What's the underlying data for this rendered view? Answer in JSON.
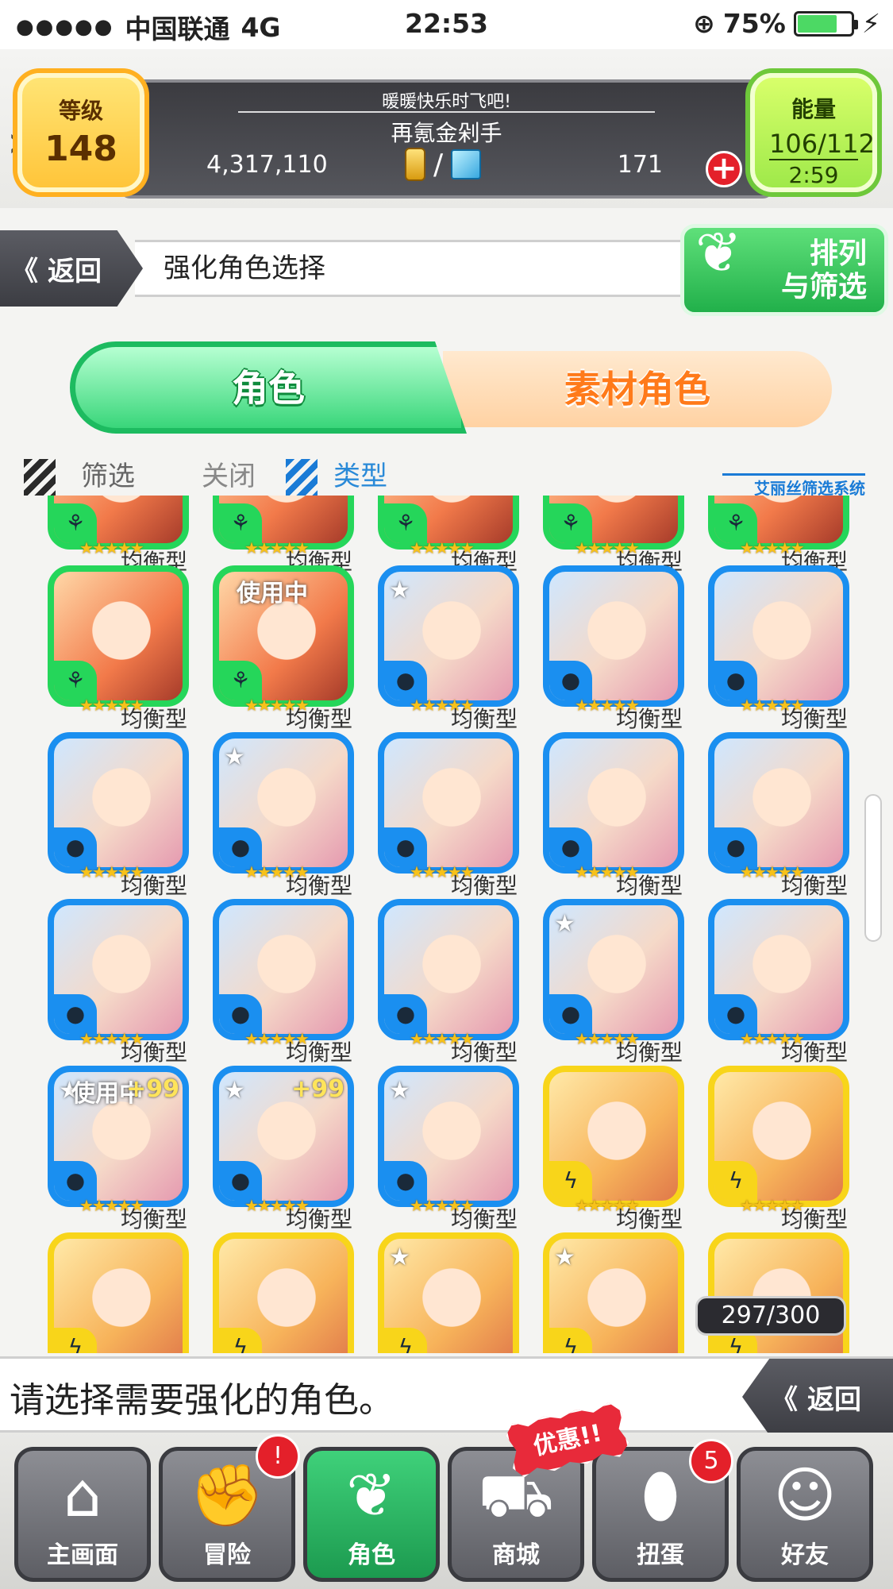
{
  "status_bar": {
    "signal": "●●●●●",
    "carrier": "中国联通",
    "network": "4G",
    "time": "22:53",
    "battery_percent": "75%",
    "battery_level": 0.75
  },
  "player": {
    "level_label": "等级",
    "level_value": "148",
    "motto": "暖暖快乐时飞吧!",
    "name": "再氪金剁手",
    "gold": "4,317,110",
    "stones": "171",
    "separator": "/",
    "energy_label": "能量",
    "energy_value": "106/112",
    "energy_timer": "2:59"
  },
  "header": {
    "back_label": "返回",
    "title": "强化角色选择",
    "sort_label_line1": "排列",
    "sort_label_line2": "与筛选"
  },
  "tabs": [
    {
      "label": "角色",
      "active": true
    },
    {
      "label": "素材角色",
      "active": false
    }
  ],
  "filter": {
    "filter_label": "筛选",
    "close_label": "关闭",
    "type_label": "类型",
    "system_label": "艾丽丝筛选系统"
  },
  "grid": {
    "rows": [
      [
        {
          "color": "green",
          "elem": "wood",
          "caption": "均衡型"
        },
        {
          "color": "green",
          "elem": "wood",
          "caption": "均衡型"
        },
        {
          "color": "green",
          "elem": "wood",
          "caption": "均衡型"
        },
        {
          "color": "green",
          "elem": "wood",
          "caption": "均衡型"
        },
        {
          "color": "green",
          "elem": "wood",
          "caption": "均衡型"
        }
      ],
      [
        {
          "color": "green",
          "elem": "wood",
          "caption": "均衡型"
        },
        {
          "color": "green",
          "elem": "wood",
          "caption": "均衡型",
          "badge": "使用中"
        },
        {
          "color": "blue",
          "elem": "water",
          "caption": "均衡型",
          "star": true
        },
        {
          "color": "blue",
          "elem": "water",
          "caption": "均衡型"
        },
        {
          "color": "blue",
          "elem": "water",
          "caption": "均衡型"
        }
      ],
      [
        {
          "color": "blue",
          "elem": "water",
          "caption": "均衡型"
        },
        {
          "color": "blue",
          "elem": "water",
          "caption": "均衡型",
          "star": true
        },
        {
          "color": "blue",
          "elem": "water",
          "caption": "均衡型"
        },
        {
          "color": "blue",
          "elem": "water",
          "caption": "均衡型"
        },
        {
          "color": "blue",
          "elem": "water",
          "caption": "均衡型"
        }
      ],
      [
        {
          "color": "blue",
          "elem": "water",
          "caption": "均衡型"
        },
        {
          "color": "blue",
          "elem": "water",
          "caption": "均衡型"
        },
        {
          "color": "blue",
          "elem": "water",
          "caption": "均衡型"
        },
        {
          "color": "blue",
          "elem": "water",
          "caption": "均衡型",
          "star": true
        },
        {
          "color": "blue",
          "elem": "water",
          "caption": "均衡型"
        }
      ],
      [
        {
          "color": "blue",
          "elem": "water",
          "caption": "均衡型",
          "star": true,
          "plus": "+99",
          "badge": "使用中"
        },
        {
          "color": "blue",
          "elem": "water",
          "caption": "均衡型",
          "star": true,
          "plus": "+99"
        },
        {
          "color": "blue",
          "elem": "water",
          "caption": "均衡型",
          "star": true
        },
        {
          "color": "yellow",
          "elem": "light",
          "caption": "均衡型"
        },
        {
          "color": "yellow",
          "elem": "light",
          "caption": "均衡型"
        }
      ],
      [
        {
          "color": "yellow",
          "elem": "light",
          "caption": ""
        },
        {
          "color": "yellow",
          "elem": "light",
          "caption": ""
        },
        {
          "color": "yellow",
          "elem": "light",
          "caption": "",
          "star": true
        },
        {
          "color": "yellow",
          "elem": "light",
          "caption": "",
          "star": true
        },
        {
          "color": "yellow",
          "elem": "light",
          "caption": ""
        }
      ]
    ],
    "count": "297/300",
    "star_glyph": "★",
    "stars": "★★★★★"
  },
  "instruction": {
    "text": "请选择需要强化的角色。",
    "back_label": "返回"
  },
  "bottom_nav": [
    {
      "label": "主画面",
      "icon": "home-icon"
    },
    {
      "label": "冒险",
      "icon": "fist-icon",
      "badge": "!"
    },
    {
      "label": "角色",
      "icon": "rabbit-icon",
      "active": true
    },
    {
      "label": "商城",
      "icon": "cart-icon"
    },
    {
      "label": "扭蛋",
      "icon": "egg-icon",
      "badge": "5"
    },
    {
      "label": "好友",
      "icon": "friends-icon"
    }
  ],
  "promo_label": "优惠!!",
  "colors": {
    "green": "#25d65a",
    "blue": "#1a8ff0",
    "yellow": "#f8d51a",
    "accent_orange": "#ff7a1a"
  }
}
